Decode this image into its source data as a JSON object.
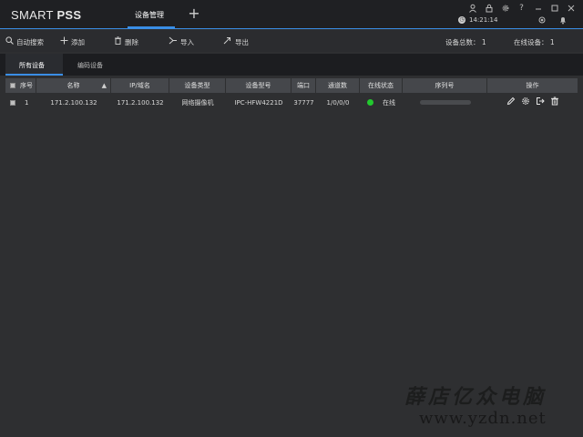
{
  "app": {
    "logo_light": "SMART ",
    "logo_bold": "PSS"
  },
  "header": {
    "main_tab": "设备管理",
    "add_tab_symbol": "+",
    "time": "14:21:14"
  },
  "toolbar": {
    "auto_search": "自动搜索",
    "add": "添加",
    "delete": "删除",
    "import": "导入",
    "export": "导出",
    "device_total_label": "设备总数：",
    "device_total_value": "1",
    "online_label": "在线设备：",
    "online_value": "1"
  },
  "subtabs": {
    "all_devices": "所有设备",
    "encoder_devices": "编码设备"
  },
  "table": {
    "columns": [
      "序号",
      "名称",
      "IP/域名",
      "设备类型",
      "设备型号",
      "端口",
      "通道数",
      "在线状态",
      "序列号",
      "操作"
    ],
    "rows": [
      {
        "index": "1",
        "name": "171.2.100.132",
        "ip": "171.2.100.132",
        "type": "网络摄像机",
        "model": "IPC-HFW4221D",
        "port": "37777",
        "channels": "1/0/0/0",
        "status": "在线",
        "status_color": "#22c92e"
      }
    ]
  },
  "watermark": {
    "line1": "薛店亿众电脑",
    "line2": "www.yzdn.net"
  },
  "colors": {
    "accent": "#3a8ee6",
    "online": "#22c92e"
  }
}
